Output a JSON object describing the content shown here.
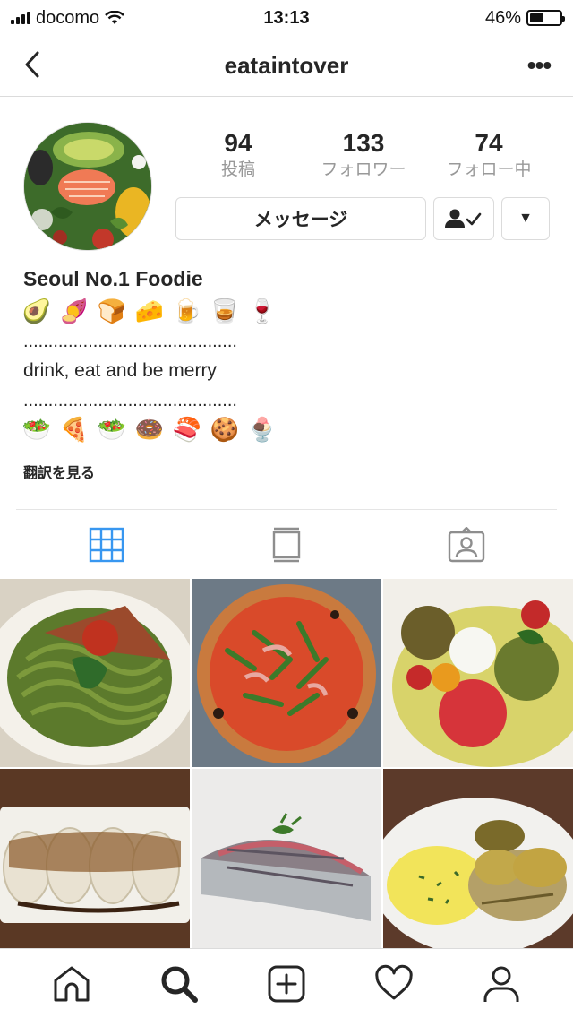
{
  "status_bar": {
    "carrier": "docomo",
    "time": "13:13",
    "battery_percent": "46%",
    "battery_level": 0.46
  },
  "nav": {
    "title": "eataintover",
    "more_label": "•••"
  },
  "profile": {
    "stats": [
      {
        "value": "94",
        "label": "投稿"
      },
      {
        "value": "133",
        "label": "フォロワー"
      },
      {
        "value": "74",
        "label": "フォロー中"
      }
    ],
    "message_button": "メッセージ",
    "dropdown_label": "▼",
    "display_name": "Seoul No.1 Foodie",
    "emoji_row_1": [
      "🥑",
      "🍠",
      "🍞",
      "🧀",
      "🍺",
      "🥃",
      "🍷"
    ],
    "dots": "...........................................",
    "bio_text": "drink, eat and be merry",
    "emoji_row_2": [
      "🥗",
      "🍕",
      "🥗",
      "🍩",
      "🍣",
      "🍪",
      "🍨"
    ],
    "translate_link": "翻訳を見る"
  },
  "colors": {
    "accent": "#3897f0",
    "icon_gray": "#8e8e8e",
    "text": "#262626",
    "border": "#dbdbdb"
  },
  "tabs": {
    "items": [
      {
        "name": "grid-view",
        "icon": "grid-icon",
        "active": true
      },
      {
        "name": "feed-view",
        "icon": "feed-icon",
        "active": false
      },
      {
        "name": "tagged-view",
        "icon": "tagged-icon",
        "active": false
      }
    ]
  },
  "grid_posts": [
    {
      "subject": "pasta"
    },
    {
      "subject": "pizza"
    },
    {
      "subject": "tomato-salad"
    },
    {
      "subject": "dumplings"
    },
    {
      "subject": "sushi"
    },
    {
      "subject": "potatoes"
    }
  ],
  "bottom_nav": {
    "items": [
      {
        "name": "home",
        "icon": "home-icon"
      },
      {
        "name": "search",
        "icon": "search-icon"
      },
      {
        "name": "add",
        "icon": "add-post-icon"
      },
      {
        "name": "activity",
        "icon": "heart-icon"
      },
      {
        "name": "profile",
        "icon": "profile-icon"
      }
    ]
  }
}
